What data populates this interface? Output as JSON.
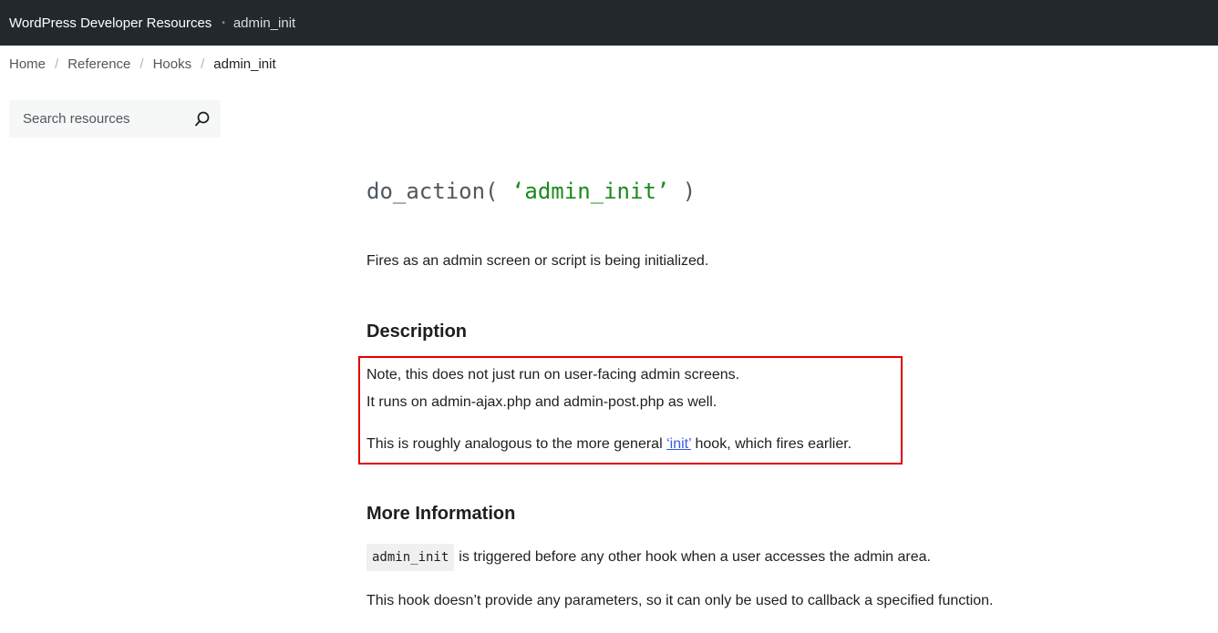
{
  "header": {
    "site_title": "WordPress Developer Resources",
    "separator": "•",
    "page_label": "admin_init"
  },
  "breadcrumb": {
    "items": [
      "Home",
      "Reference",
      "Hooks"
    ],
    "separator": "/",
    "current": "admin_init"
  },
  "search": {
    "placeholder": "Search resources",
    "value": "",
    "icon": "search-icon"
  },
  "main": {
    "signature": {
      "func": "do_action(",
      "arg": "‘admin_init’",
      "close": ")"
    },
    "summary": "Fires as an admin screen or script is being initialized.",
    "description_heading": "Description",
    "description": {
      "line1": "Note, this does not just run on user-facing admin screens.",
      "line2": "It runs on admin-ajax.php and admin-post.php as well.",
      "line3_before": "This is roughly analogous to the more general ",
      "line3_link": "‘init’",
      "line3_after": " hook, which fires earlier."
    },
    "more_heading": "More Information",
    "more": {
      "code": "admin_init",
      "line1_after": "is triggered before any other hook when a user accesses the admin area.",
      "line2": "This hook doesn’t provide any parameters, so it can only be used to callback a specified function."
    }
  },
  "colors": {
    "topbar": "#23282d",
    "link": "#3858e9",
    "string": "#1a8b1a",
    "highlight": "#e00000"
  }
}
